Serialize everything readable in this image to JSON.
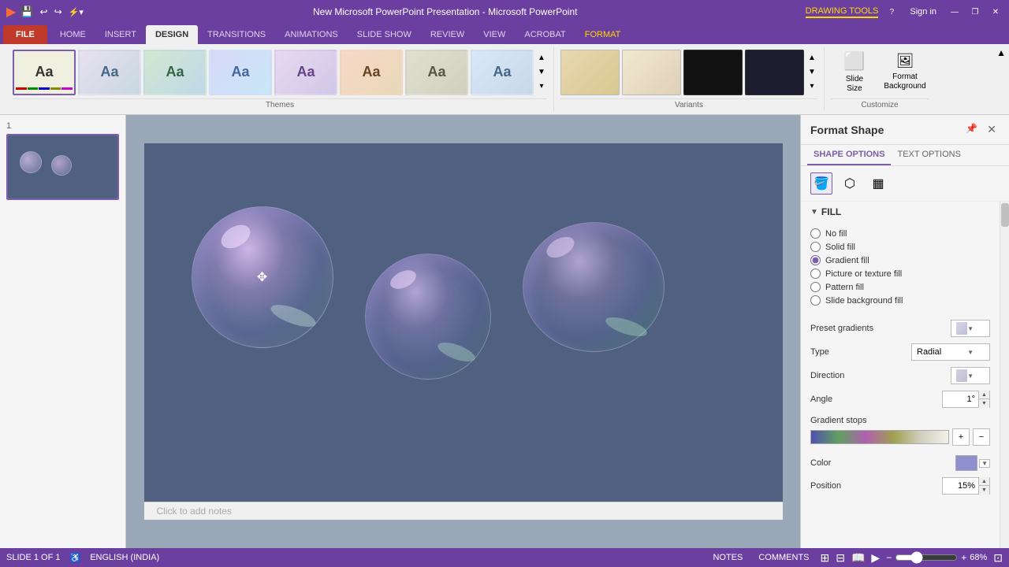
{
  "titlebar": {
    "app_icons": [
      "🎨",
      "💾",
      "↩",
      "↪",
      "⚡"
    ],
    "title": "New Microsoft PowerPoint Presentation - Microsoft PowerPoint",
    "drawing_tools": "DRAWING TOOLS",
    "win_buttons": [
      "?",
      "—",
      "❐",
      "✕"
    ]
  },
  "ribbon": {
    "tabs": [
      {
        "id": "file",
        "label": "FILE"
      },
      {
        "id": "home",
        "label": "HOME"
      },
      {
        "id": "insert",
        "label": "INSERT"
      },
      {
        "id": "design",
        "label": "DESIGN",
        "active": true
      },
      {
        "id": "transitions",
        "label": "TRANSITIONS"
      },
      {
        "id": "animations",
        "label": "ANIMATIONS"
      },
      {
        "id": "slideshow",
        "label": "SLIDE SHOW"
      },
      {
        "id": "review",
        "label": "REVIEW"
      },
      {
        "id": "view",
        "label": "VIEW"
      },
      {
        "id": "acrobat",
        "label": "ACROBAT"
      },
      {
        "id": "format",
        "label": "FORMAT"
      }
    ],
    "sections": {
      "themes": {
        "label": "Themes"
      },
      "variants": {
        "label": "Variants"
      },
      "customize": {
        "label": "Customize"
      }
    },
    "customize_buttons": [
      {
        "id": "slide-size",
        "icon": "⬜",
        "label": "Slide\nSize"
      },
      {
        "id": "format-background",
        "icon": "🖼",
        "label": "Format\nBackground"
      }
    ],
    "themes": [
      {
        "id": "t1",
        "label": "Aa",
        "class": "theme1",
        "active": true
      },
      {
        "id": "t2",
        "label": "Aa",
        "class": "theme2"
      },
      {
        "id": "t3",
        "label": "Aa",
        "class": "theme3"
      },
      {
        "id": "t4",
        "label": "Aa",
        "class": "theme4"
      },
      {
        "id": "t5",
        "label": "Aa",
        "class": "theme5"
      },
      {
        "id": "t6",
        "label": "Aa",
        "class": "theme6"
      },
      {
        "id": "t7",
        "label": "Aa",
        "class": "theme7"
      },
      {
        "id": "t8",
        "label": "Aa",
        "class": "theme8"
      }
    ],
    "variants": [
      {
        "id": "v1",
        "class": "var1"
      },
      {
        "id": "v2",
        "class": "var2"
      },
      {
        "id": "v3",
        "class": "var3"
      },
      {
        "id": "v4",
        "class": "var4"
      }
    ]
  },
  "slide_panel": {
    "slide_number": "1",
    "slide_label": "Slide 1"
  },
  "canvas": {
    "notes_placeholder": "Click to add notes"
  },
  "format_shape": {
    "title": "Format Shape",
    "pin_icon": "📌",
    "close_icon": "✕",
    "tabs": [
      {
        "id": "shape-options",
        "label": "SHAPE OPTIONS",
        "active": true
      },
      {
        "id": "text-options",
        "label": "TEXT OPTIONS"
      }
    ],
    "icons": [
      {
        "id": "fill-icon",
        "symbol": "🪣",
        "active": true
      },
      {
        "id": "effects-icon",
        "symbol": "⬡"
      },
      {
        "id": "layout-icon",
        "symbol": "▦"
      }
    ],
    "fill": {
      "section_title": "FILL",
      "options": [
        {
          "id": "no-fill",
          "label": "No fill",
          "checked": false
        },
        {
          "id": "solid-fill",
          "label": "Solid fill",
          "checked": false
        },
        {
          "id": "gradient-fill",
          "label": "Gradient fill",
          "checked": true
        },
        {
          "id": "picture-fill",
          "label": "Picture or texture fill",
          "checked": false
        },
        {
          "id": "pattern-fill",
          "label": "Pattern fill",
          "checked": false
        },
        {
          "id": "slide-bg-fill",
          "label": "Slide background fill",
          "checked": false
        }
      ],
      "preset_gradients": {
        "label": "Preset gradients",
        "value": ""
      },
      "type": {
        "label": "Type",
        "value": "Radial"
      },
      "direction": {
        "label": "Direction",
        "value": ""
      },
      "angle": {
        "label": "Angle",
        "value": "1°"
      },
      "gradient_stops": {
        "label": "Gradient stops"
      },
      "color": {
        "label": "Color",
        "value": ""
      },
      "position": {
        "label": "Position",
        "value": "15%"
      }
    }
  },
  "status_bar": {
    "slide_info": "SLIDE 1 OF 1",
    "language": "ENGLISH (INDIA)",
    "notes": "NOTES",
    "comments": "COMMENTS",
    "zoom_level": "68%",
    "zoom_value": "68"
  }
}
